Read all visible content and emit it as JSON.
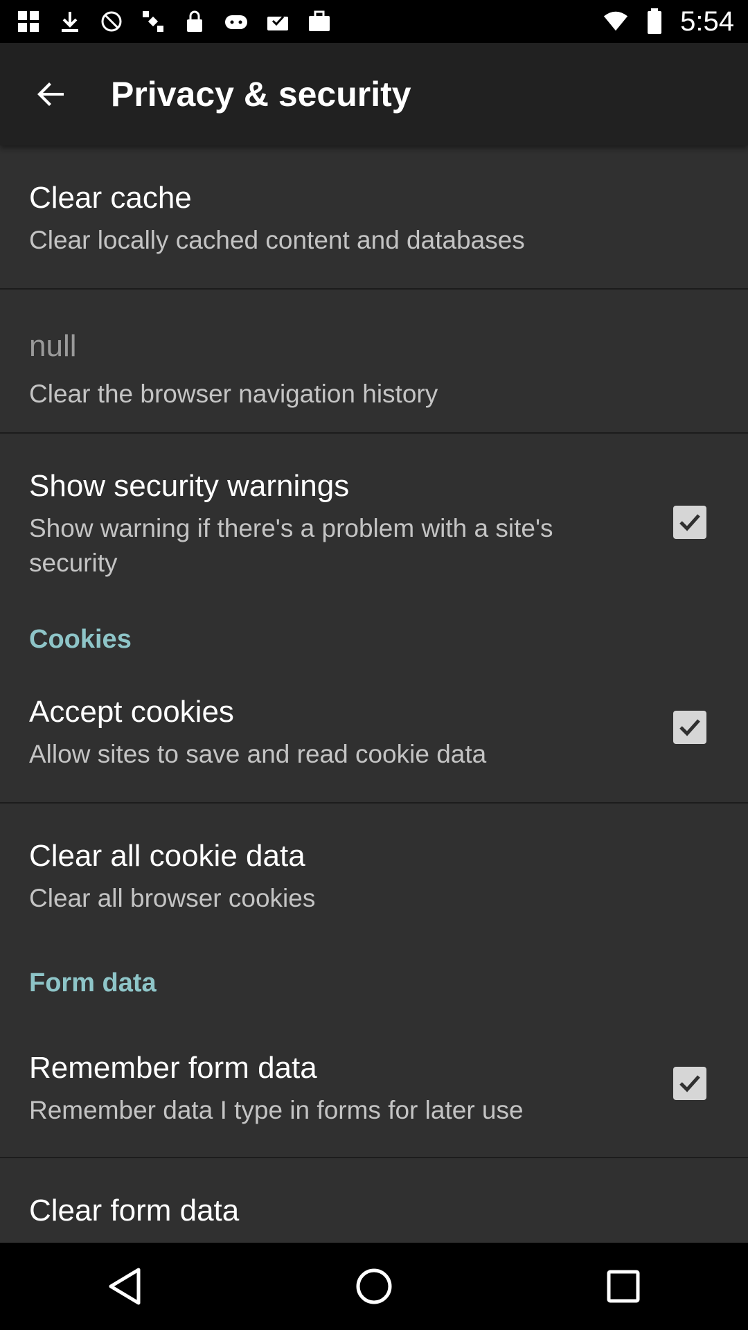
{
  "status_bar": {
    "time": "5:54",
    "left_icons": [
      "grid-icon",
      "download-icon",
      "no-sign-icon",
      "satellite-icon",
      "lock-icon",
      "game-icon",
      "inbox-check-icon",
      "briefcase-icon"
    ],
    "right_icons": [
      "wifi-icon",
      "battery-icon"
    ]
  },
  "appbar": {
    "title": "Privacy & security",
    "back_icon": "arrow-back-icon"
  },
  "items": [
    {
      "title": "Clear cache",
      "subtitle": "Clear locally cached content and databases"
    },
    {
      "title": "null",
      "subtitle": "Clear the browser navigation history"
    },
    {
      "title": "Show security warnings",
      "subtitle": "Show warning if there's a problem with a site's security",
      "checked": true
    },
    {
      "title": "Accept cookies",
      "subtitle": "Allow sites to save and read cookie data",
      "checked": true
    },
    {
      "title": "Clear all cookie data",
      "subtitle": "Clear all browser cookies"
    },
    {
      "title": "Remember form data",
      "subtitle": "Remember data I type in forms for later use",
      "checked": true
    },
    {
      "title": "Clear form data"
    }
  ],
  "sections": {
    "cookies": "Cookies",
    "form_data": "Form data"
  },
  "colors": {
    "background": "#303030",
    "appbar": "#212121",
    "section_header": "#8ec5c8",
    "checkbox": "#d6d6d6"
  },
  "nav_icons": [
    "back-triangle-icon",
    "home-circle-icon",
    "recents-square-icon"
  ]
}
